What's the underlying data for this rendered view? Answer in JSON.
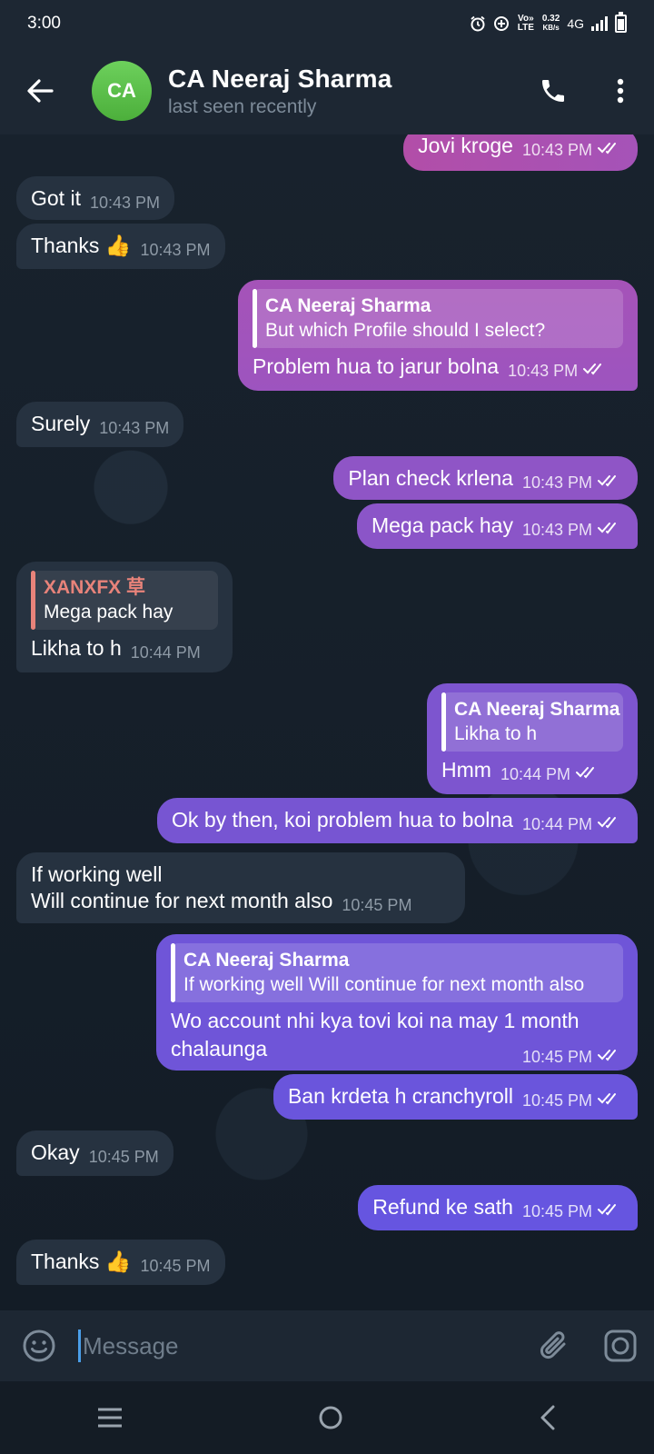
{
  "status_bar": {
    "time": "3:00",
    "volte": "Vo» LTE",
    "speed_value": "0.32",
    "speed_unit": "KB/s",
    "network": "4G",
    "icons": [
      "alarm-icon",
      "data-saver-icon",
      "signal-icon",
      "battery-icon"
    ]
  },
  "header": {
    "avatar_initials": "CA",
    "contact_name": "CA Neeraj Sharma",
    "last_seen": "last seen recently",
    "avatar_color": "#5cc04a",
    "icons": [
      "back-arrow-icon",
      "phone-icon",
      "more-vert-icon"
    ]
  },
  "messages": [
    {
      "direction": "out",
      "text": "Jovi kroge",
      "time": "10:43 PM"
    },
    {
      "direction": "in",
      "text": "Got it",
      "time": "10:43 PM"
    },
    {
      "direction": "in",
      "text": "Thanks 👍",
      "time": "10:43 PM"
    },
    {
      "direction": "out",
      "quote_name": "CA Neeraj Sharma",
      "quote_text": "But which Profile should I select?",
      "text": "Problem hua to jarur bolna",
      "time": "10:43 PM"
    },
    {
      "direction": "in",
      "text": "Surely",
      "time": "10:43 PM"
    },
    {
      "direction": "out",
      "text": "Plan check krlena",
      "time": "10:43 PM"
    },
    {
      "direction": "out",
      "text": "Mega pack hay",
      "time": "10:43 PM"
    },
    {
      "direction": "in",
      "quote_name": "XANXFX 草",
      "quote_text": "Mega pack hay",
      "text": "Likha to h",
      "time": "10:44 PM"
    },
    {
      "direction": "out",
      "quote_name": "CA Neeraj Sharma",
      "quote_text": "Likha to h",
      "text": "Hmm",
      "time": "10:44 PM"
    },
    {
      "direction": "out",
      "text": "Ok by then, koi problem hua to bolna",
      "time": "10:44 PM"
    },
    {
      "direction": "in",
      "text_line1": "If working well",
      "text_line2": "Will continue for next month also",
      "time": "10:45 PM"
    },
    {
      "direction": "out",
      "quote_name": "CA Neeraj Sharma",
      "quote_text": "If working well  Will continue for next month also",
      "text_line1": "Wo account nhi kya tovi koi na may 1 month",
      "text_line2": "chalaunga",
      "time": "10:45 PM"
    },
    {
      "direction": "out",
      "text": "Ban krdeta h cranchyroll",
      "time": "10:45 PM"
    },
    {
      "direction": "in",
      "text": "Okay",
      "time": "10:45 PM"
    },
    {
      "direction": "out",
      "text": "Refund ke sath",
      "time": "10:45 PM"
    },
    {
      "direction": "in",
      "text": "Thanks 👍",
      "time": "10:45 PM"
    }
  ],
  "input": {
    "placeholder": "Message",
    "icons": [
      "emoji-icon",
      "attach-icon",
      "camera-icon"
    ]
  },
  "nav": {
    "icons": [
      "recent-apps-icon",
      "home-icon",
      "back-icon"
    ]
  },
  "colors": {
    "outgoing_top": "#a553b8",
    "outgoing_bottom": "#6a55e0",
    "incoming": "#263240",
    "background": "#111a24",
    "header": "#1d2733"
  }
}
